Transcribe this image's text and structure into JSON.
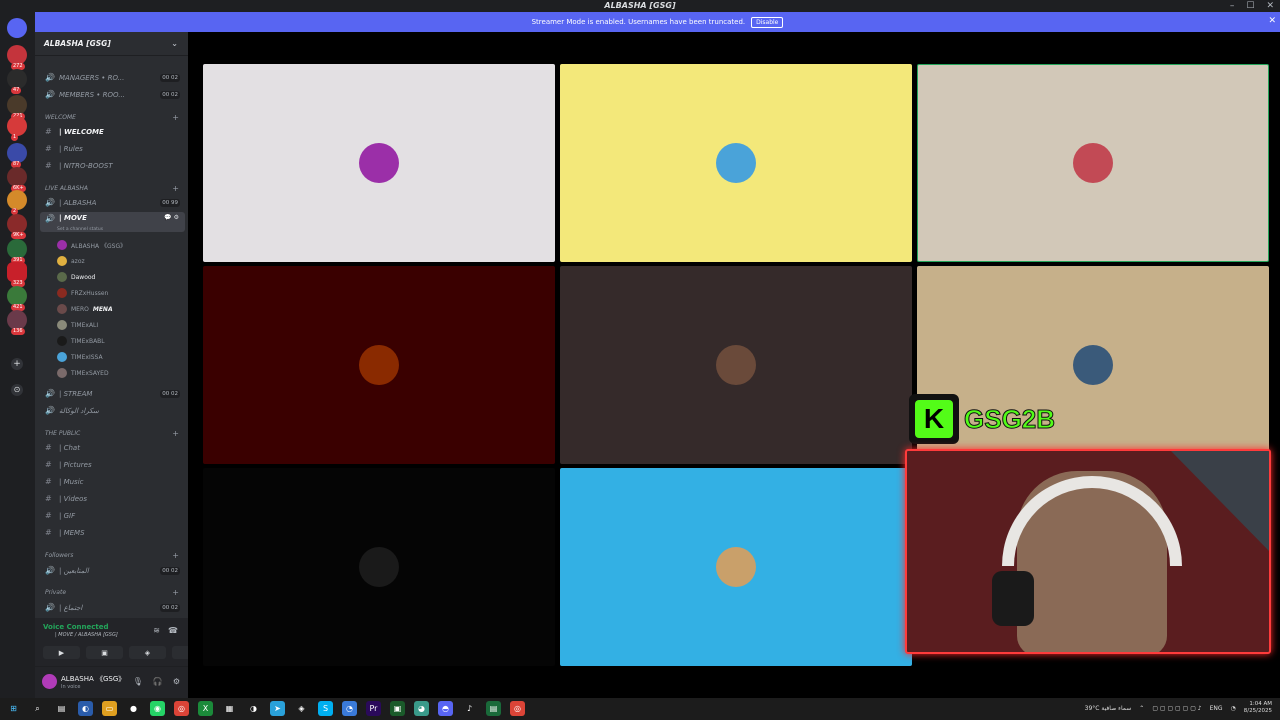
{
  "window": {
    "title": "ALBASHA [GSG]"
  },
  "banner": {
    "text": "Streamer Mode is enabled. Usernames have been truncated.",
    "disable_label": "Disable"
  },
  "servers": [
    {
      "badge": "272"
    },
    {
      "badge": "47"
    },
    {
      "badge": "221"
    },
    {
      "badge": "1"
    },
    {
      "badge": "87"
    },
    {
      "badge": "6K+"
    },
    {
      "badge": "2"
    },
    {
      "badge": "9K+"
    },
    {
      "badge": "391"
    },
    {
      "badge": "323"
    },
    {
      "badge": "421"
    },
    {
      "badge": "136"
    }
  ],
  "guild": {
    "name": "ALBASHA [GSG]"
  },
  "channels": {
    "managers": {
      "name": "MANAGERS • RO...",
      "count": "00 02"
    },
    "members": {
      "name": "MEMBERS • ROO...",
      "count": "00 02"
    },
    "cat_welcome": "WELCOME",
    "welcome": "| WELCOME",
    "rules": "| Rules",
    "nitro": "| NITRO-BOOST",
    "cat_live": "Live ALBASHA",
    "albasha": {
      "name": "| ALBASHA",
      "count": "00 99"
    },
    "move": "| MOVE",
    "move_status": "Set a channel status",
    "users": [
      "ALBASHA 《GSG》",
      "azoz",
      "Dawood",
      "FRZxHussen",
      "MERO",
      "TIMExALI",
      "TIMExBABL",
      "TIMExISSA",
      "TIMExSAYED"
    ],
    "mero_tag": "MENA",
    "stream": {
      "name": "| STREAM",
      "count": "00 02"
    },
    "stream_sub": "سكراد الوكالة",
    "cat_public": "THE PUBLIC",
    "chat": "| Chat",
    "pictures": "| Pictures",
    "music": "| Music",
    "videos": "| Videos",
    "gif": "| GIF",
    "mems": "| MEMS",
    "cat_followers": "Followers",
    "followers_ch": {
      "name": "| المتابعين",
      "count": "00 02"
    },
    "cat_private": "Private",
    "private_ch": {
      "name": "| اجتماع",
      "count": "00 02"
    }
  },
  "voice": {
    "status": "Voice Connected",
    "channel": "| MOVE / ALBASHA [GSG]"
  },
  "user": {
    "name": "ALBASHA 《GSG》",
    "status": "In voice"
  },
  "tiles": [
    {
      "bg": "#e3e0e3",
      "avatar": "#9b2fa8"
    },
    {
      "bg": "#f3e87a",
      "avatar": "#4aa3d9"
    },
    {
      "bg": "#d2c8b8",
      "avatar": "#c24a55"
    },
    {
      "bg": "#3a0000",
      "avatar": "#8a2a00"
    },
    {
      "bg": "#352a2a",
      "avatar": "#6a4a3a"
    },
    {
      "bg": "#c6b08a",
      "avatar": "#3a5a7a"
    },
    {
      "bg": "#050505",
      "avatar": "#1a1a1a"
    },
    {
      "bg": "#33b0e4",
      "avatar": "#c9a06a"
    }
  ],
  "overlay": {
    "kick_letter": "K",
    "streamer": "GSG2B"
  },
  "taskbar": {
    "weather": "39°C سماء صافية",
    "lang": "ENG",
    "time": "1:04 AM",
    "date": "8/25/2025"
  }
}
